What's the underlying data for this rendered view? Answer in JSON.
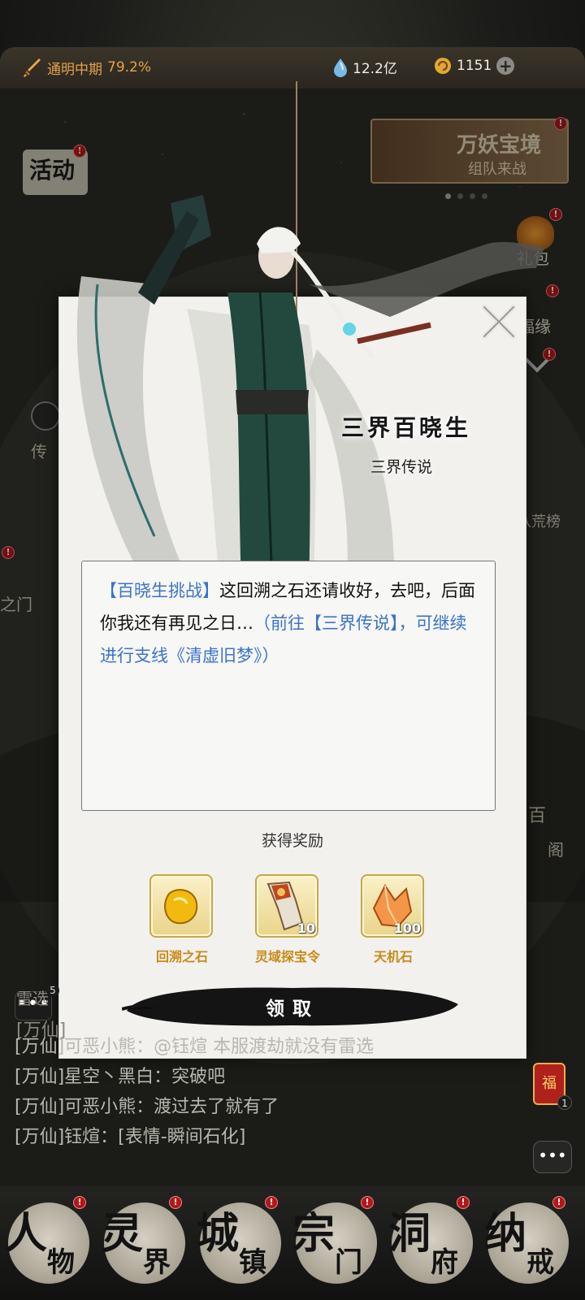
{
  "top_bar": {
    "realm": "通明中期",
    "realm_progress": "79.2%",
    "spirit_stones": "12.2亿",
    "currency": "1151",
    "plus_icon": "plus-icon"
  },
  "background": {
    "activity_label": "活动",
    "wanyao_title": "万妖宝境",
    "wanyao_sub": "组队来战",
    "gift_label": "礼包",
    "fuyuan_label": "福缘",
    "left_mail_label": "传",
    "left_gate_label": "之门",
    "rank_label": "八荒榜",
    "right_pavilion_label": "阁",
    "right_pavilion_top": "百"
  },
  "modal": {
    "npc_name": "三界百晓生",
    "npc_subtitle": "三界传说",
    "dialog": {
      "tag": "【百晓生挑战】",
      "text": "这回溯之石还请收好，去吧，后面你我还有再见之日…",
      "hint": "（前往【三界传说】，可继续进行支线《清虚旧梦》）"
    },
    "reward_title": "获得奖励",
    "rewards": [
      {
        "name": "回溯之石",
        "qty": "",
        "icon": "gold-stone-icon"
      },
      {
        "name": "灵域探宝令",
        "qty": "10",
        "icon": "treasure-token-icon"
      },
      {
        "name": "天机石",
        "qty": "100",
        "icon": "orange-crystal-icon"
      }
    ],
    "claim_label": "领取"
  },
  "chat": {
    "badge_count": "5",
    "lines": [
      "雷选",
      "[万仙]",
      "[万仙]可恶小熊：@钰煊 本服渡劫就没有雷选",
      "[万仙]星空丶黑白：突破吧",
      "[万仙]可恶小熊：渡过去了就有了",
      "[万仙]钰煊：[表情-瞬间石化]"
    ],
    "fu_label": "福",
    "fu_count": "1"
  },
  "bottom_nav": [
    {
      "c1": "人",
      "c2": "物"
    },
    {
      "c1": "灵",
      "c2": "界"
    },
    {
      "c1": "城",
      "c2": "镇"
    },
    {
      "c1": "宗",
      "c2": "门"
    },
    {
      "c1": "洞",
      "c2": "府"
    },
    {
      "c1": "纳",
      "c2": "戒"
    }
  ],
  "colors": {
    "realm_text": "#e6a24a",
    "hint_blue": "#3d73c8",
    "reward_name": "#c98a18",
    "red_dot": "#b5161a"
  }
}
